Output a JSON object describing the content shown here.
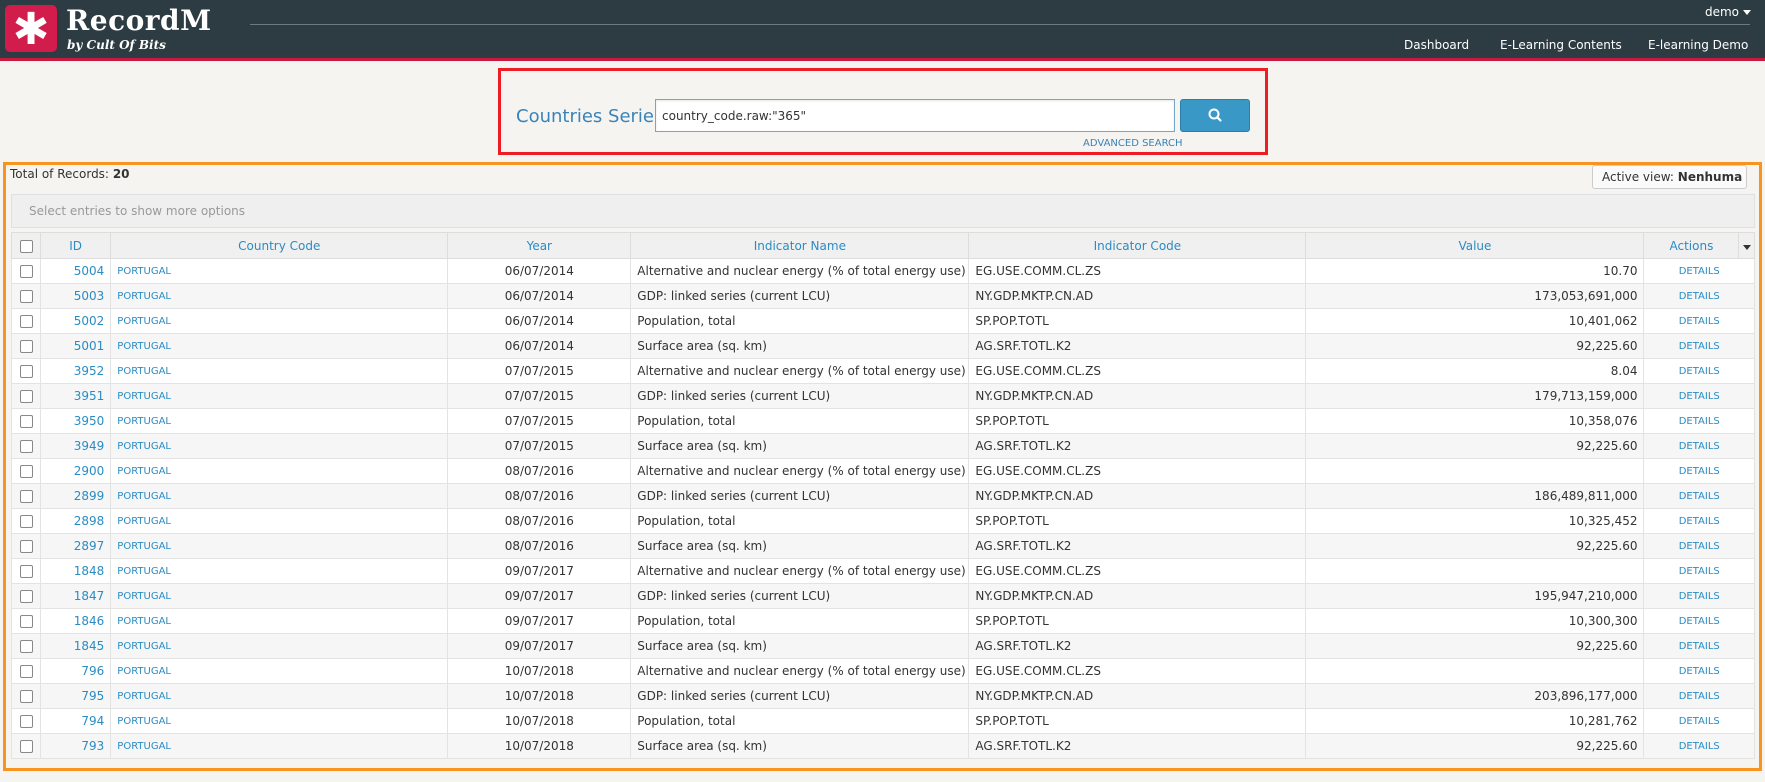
{
  "header": {
    "brand": "RecordM",
    "brand_sub": "by Cult Of Bits",
    "user": "demo",
    "nav": [
      "Dashboard",
      "E-Learning Contents",
      "E-learning Demo"
    ]
  },
  "search": {
    "title": "Countries Series",
    "query": "country_code.raw:\"365\"",
    "advanced": "ADVANCED SEARCH"
  },
  "results": {
    "total_label": "Total of Records:",
    "total": "20",
    "active_view_label": "Active view:",
    "active_view": "Nenhuma",
    "select_hint": "Select entries to show more options",
    "columns": [
      "ID",
      "Country Code",
      "Year",
      "Indicator Name",
      "Indicator Code",
      "Value",
      "Actions"
    ],
    "rows": [
      {
        "id": "5004",
        "cc": "PORTUGAL",
        "year": "06/07/2014",
        "name": "Alternative and nuclear energy (% of total energy use)",
        "code": "EG.USE.COMM.CL.ZS",
        "value": "10.70",
        "action": "DETAILS"
      },
      {
        "id": "5003",
        "cc": "PORTUGAL",
        "year": "06/07/2014",
        "name": "GDP: linked series (current LCU)",
        "code": "NY.GDP.MKTP.CN.AD",
        "value": "173,053,691,000",
        "action": "DETAILS"
      },
      {
        "id": "5002",
        "cc": "PORTUGAL",
        "year": "06/07/2014",
        "name": "Population, total",
        "code": "SP.POP.TOTL",
        "value": "10,401,062",
        "action": "DETAILS"
      },
      {
        "id": "5001",
        "cc": "PORTUGAL",
        "year": "06/07/2014",
        "name": "Surface area (sq. km)",
        "code": "AG.SRF.TOTL.K2",
        "value": "92,225.60",
        "action": "DETAILS"
      },
      {
        "id": "3952",
        "cc": "PORTUGAL",
        "year": "07/07/2015",
        "name": "Alternative and nuclear energy (% of total energy use)",
        "code": "EG.USE.COMM.CL.ZS",
        "value": "8.04",
        "action": "DETAILS"
      },
      {
        "id": "3951",
        "cc": "PORTUGAL",
        "year": "07/07/2015",
        "name": "GDP: linked series (current LCU)",
        "code": "NY.GDP.MKTP.CN.AD",
        "value": "179,713,159,000",
        "action": "DETAILS"
      },
      {
        "id": "3950",
        "cc": "PORTUGAL",
        "year": "07/07/2015",
        "name": "Population, total",
        "code": "SP.POP.TOTL",
        "value": "10,358,076",
        "action": "DETAILS"
      },
      {
        "id": "3949",
        "cc": "PORTUGAL",
        "year": "07/07/2015",
        "name": "Surface area (sq. km)",
        "code": "AG.SRF.TOTL.K2",
        "value": "92,225.60",
        "action": "DETAILS"
      },
      {
        "id": "2900",
        "cc": "PORTUGAL",
        "year": "08/07/2016",
        "name": "Alternative and nuclear energy (% of total energy use)",
        "code": "EG.USE.COMM.CL.ZS",
        "value": "",
        "action": "DETAILS"
      },
      {
        "id": "2899",
        "cc": "PORTUGAL",
        "year": "08/07/2016",
        "name": "GDP: linked series (current LCU)",
        "code": "NY.GDP.MKTP.CN.AD",
        "value": "186,489,811,000",
        "action": "DETAILS"
      },
      {
        "id": "2898",
        "cc": "PORTUGAL",
        "year": "08/07/2016",
        "name": "Population, total",
        "code": "SP.POP.TOTL",
        "value": "10,325,452",
        "action": "DETAILS"
      },
      {
        "id": "2897",
        "cc": "PORTUGAL",
        "year": "08/07/2016",
        "name": "Surface area (sq. km)",
        "code": "AG.SRF.TOTL.K2",
        "value": "92,225.60",
        "action": "DETAILS"
      },
      {
        "id": "1848",
        "cc": "PORTUGAL",
        "year": "09/07/2017",
        "name": "Alternative and nuclear energy (% of total energy use)",
        "code": "EG.USE.COMM.CL.ZS",
        "value": "",
        "action": "DETAILS"
      },
      {
        "id": "1847",
        "cc": "PORTUGAL",
        "year": "09/07/2017",
        "name": "GDP: linked series (current LCU)",
        "code": "NY.GDP.MKTP.CN.AD",
        "value": "195,947,210,000",
        "action": "DETAILS"
      },
      {
        "id": "1846",
        "cc": "PORTUGAL",
        "year": "09/07/2017",
        "name": "Population, total",
        "code": "SP.POP.TOTL",
        "value": "10,300,300",
        "action": "DETAILS"
      },
      {
        "id": "1845",
        "cc": "PORTUGAL",
        "year": "09/07/2017",
        "name": "Surface area (sq. km)",
        "code": "AG.SRF.TOTL.K2",
        "value": "92,225.60",
        "action": "DETAILS"
      },
      {
        "id": "796",
        "cc": "PORTUGAL",
        "year": "10/07/2018",
        "name": "Alternative and nuclear energy (% of total energy use)",
        "code": "EG.USE.COMM.CL.ZS",
        "value": "",
        "action": "DETAILS"
      },
      {
        "id": "795",
        "cc": "PORTUGAL",
        "year": "10/07/2018",
        "name": "GDP: linked series (current LCU)",
        "code": "NY.GDP.MKTP.CN.AD",
        "value": "203,896,177,000",
        "action": "DETAILS"
      },
      {
        "id": "794",
        "cc": "PORTUGAL",
        "year": "10/07/2018",
        "name": "Population, total",
        "code": "SP.POP.TOTL",
        "value": "10,281,762",
        "action": "DETAILS"
      },
      {
        "id": "793",
        "cc": "PORTUGAL",
        "year": "10/07/2018",
        "name": "Surface area (sq. km)",
        "code": "AG.SRF.TOTL.K2",
        "value": "92,225.60",
        "action": "DETAILS"
      }
    ]
  },
  "icons": {
    "logo": "asterisk-logo-icon",
    "search": "search-icon",
    "user_caret": "chevron-down-icon"
  },
  "colors": {
    "header_bg": "#2d3b42",
    "brand_red": "#d21c4b",
    "link_blue": "#2a8cc4",
    "search_button": "#3a98c6",
    "highlight_red": "#ee1c25",
    "highlight_orange": "#f7931e"
  }
}
